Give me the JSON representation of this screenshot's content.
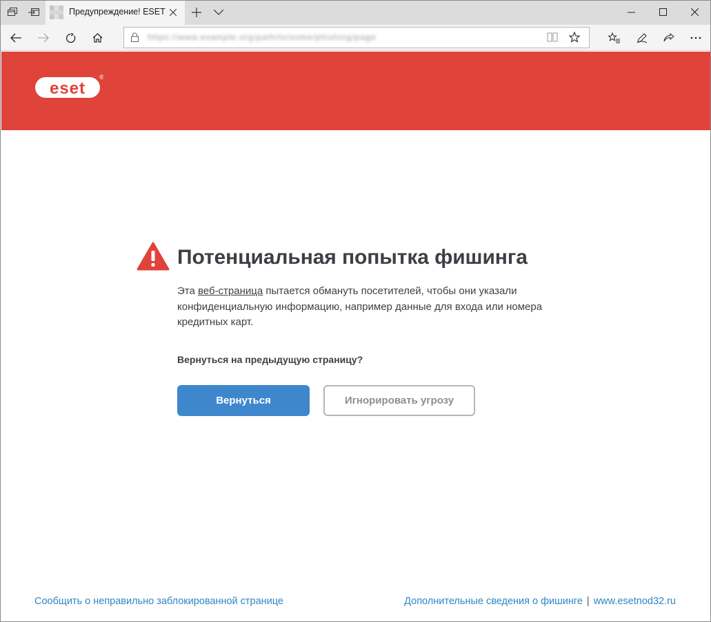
{
  "browser": {
    "tab_title": "Предупреждение! ESET",
    "url": "https://www.example.org/path/to/some/phishing/page"
  },
  "page": {
    "brand": "eset",
    "brand_mark": "®",
    "headline": "Потенциальная попытка фишинга",
    "description": {
      "prefix": "Эта ",
      "link_text": "веб-страница",
      "suffix": " пытается обмануть посетителей, чтобы они указали конфиденциальную информацию, например данные для входа или номера кредитных карт."
    },
    "question": "Вернуться на предыдущую страницу?",
    "back_button": "Вернуться",
    "ignore_button": "Игнорировать угрозу"
  },
  "footer": {
    "report_link": "Сообщить о неправильно заблокированной странице",
    "more_info_link": "Дополнительные сведения о фишинге",
    "separator": "|",
    "site_link": "www.esetnod32.ru"
  },
  "colors": {
    "banner": "#e0433a",
    "primary_button": "#3e87cd",
    "warning_icon": "#e0433a",
    "footer_link": "#2f86c2"
  }
}
